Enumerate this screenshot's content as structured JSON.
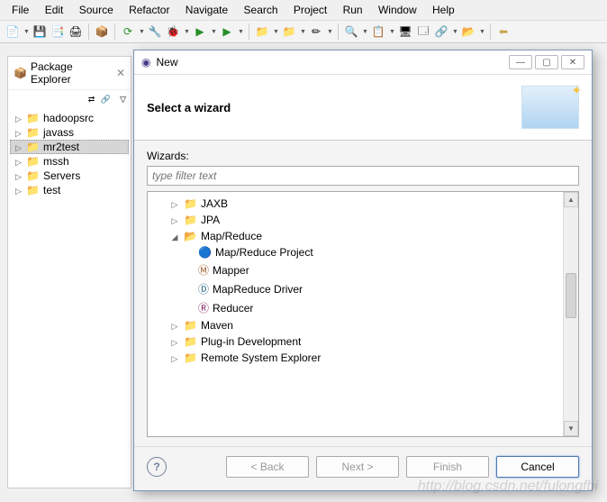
{
  "menubar": [
    "File",
    "Edit",
    "Source",
    "Refactor",
    "Navigate",
    "Search",
    "Project",
    "Run",
    "Window",
    "Help"
  ],
  "explorer": {
    "title": "Package Explorer",
    "projects": [
      {
        "name": "hadoopsrc",
        "selected": false
      },
      {
        "name": "javass",
        "selected": false
      },
      {
        "name": "mr2test",
        "selected": true
      },
      {
        "name": "mssh",
        "selected": false
      },
      {
        "name": "Servers",
        "selected": false
      },
      {
        "name": "test",
        "selected": false
      }
    ]
  },
  "dialog": {
    "title": "New",
    "header": "Select a wizard",
    "wizards_label": "Wizards:",
    "filter_placeholder": "type filter text",
    "items": [
      {
        "exp": "▷",
        "indent": 0,
        "icon": "folder",
        "label": "JAXB"
      },
      {
        "exp": "▷",
        "indent": 0,
        "icon": "folder",
        "label": "JPA"
      },
      {
        "exp": "◢",
        "indent": 0,
        "icon": "folder",
        "label": "Map/Reduce"
      },
      {
        "exp": "",
        "indent": 1,
        "icon": "mrproj",
        "label": "Map/Reduce Project"
      },
      {
        "exp": "",
        "indent": 1,
        "icon": "mapper",
        "label": "Mapper"
      },
      {
        "exp": "",
        "indent": 1,
        "icon": "driver",
        "label": "MapReduce Driver"
      },
      {
        "exp": "",
        "indent": 1,
        "icon": "reducer",
        "label": "Reducer"
      },
      {
        "exp": "▷",
        "indent": 0,
        "icon": "folder",
        "label": "Maven"
      },
      {
        "exp": "▷",
        "indent": 0,
        "icon": "folder",
        "label": "Plug-in Development"
      },
      {
        "exp": "▷",
        "indent": 0,
        "icon": "folder",
        "label": "Remote System Explorer"
      }
    ],
    "buttons": {
      "back": "< Back",
      "next": "Next >",
      "finish": "Finish",
      "cancel": "Cancel"
    }
  },
  "watermark": "http://blog.csdn.net/fulongfbi"
}
